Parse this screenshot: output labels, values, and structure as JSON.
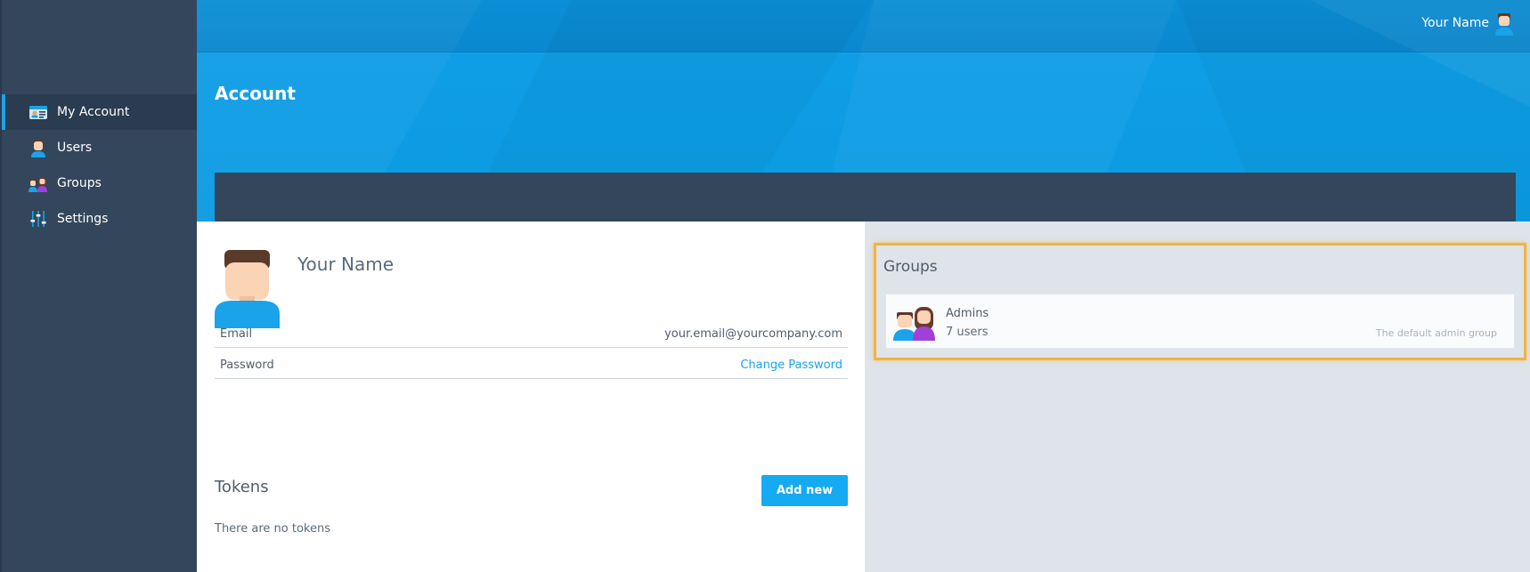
{
  "sidebar": {
    "items": [
      {
        "label": "My Account",
        "icon": "id-card-icon",
        "active": true
      },
      {
        "label": "Users",
        "icon": "user-icon",
        "active": false
      },
      {
        "label": "Groups",
        "icon": "group-icon",
        "active": false
      },
      {
        "label": "Settings",
        "icon": "sliders-icon",
        "active": false
      }
    ]
  },
  "header": {
    "user_name": "Your Name",
    "page_title": "Account"
  },
  "profile": {
    "name": "Your Name",
    "email_label": "Email",
    "email_value": "your.email@yourcompany.com",
    "password_label": "Password",
    "password_action": "Change Password"
  },
  "tokens": {
    "title": "Tokens",
    "add_label": "Add new",
    "empty_text": "There are no tokens"
  },
  "groups": {
    "title": "Groups",
    "items": [
      {
        "name": "Admins",
        "count": "7 users",
        "description": "The default admin group"
      }
    ]
  },
  "colors": {
    "accent": "#1aa3e8",
    "sidebar": "#34465c",
    "banner": "#0b9be3",
    "highlight": "#f1b43c"
  }
}
